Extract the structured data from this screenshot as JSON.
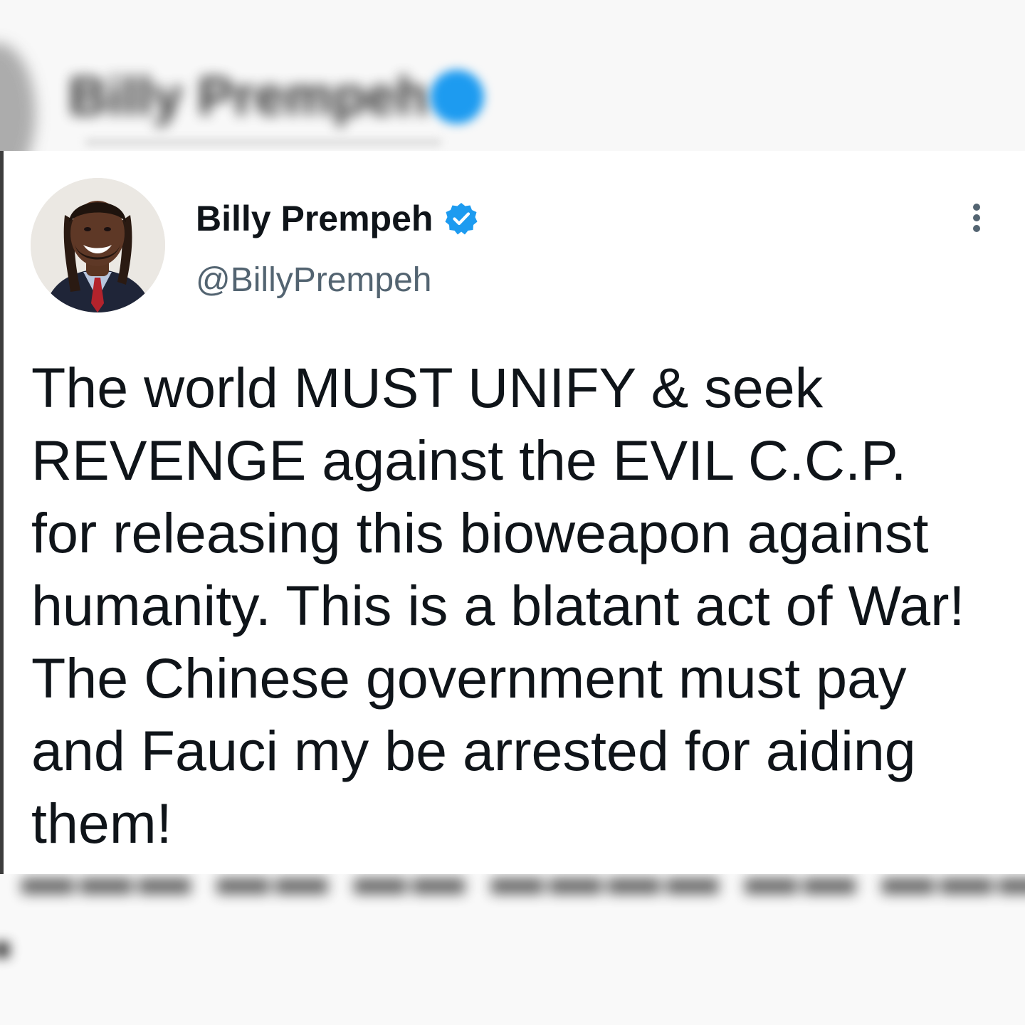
{
  "background": {
    "top_blurred_name": "Billy Prempeh"
  },
  "tweet": {
    "author": {
      "display_name": "Billy Prempeh",
      "handle": "@BillyPrempeh",
      "verified": true
    },
    "text_lines": [
      "The world MUST UNIFY & seek",
      "REVENGE against the EVIL C.C.P.",
      "for releasing this bioweapon against",
      "humanity. This is a blatant act of War!",
      "The Chinese government must pay",
      "and Fauci my be arrested for aiding",
      "them!"
    ]
  },
  "icons": {
    "verified": "verified-badge-icon",
    "more": "more-options-icon"
  },
  "colors": {
    "verified_blue": "#1d9bf0",
    "text_primary": "#0f1419",
    "text_secondary": "#536471"
  }
}
